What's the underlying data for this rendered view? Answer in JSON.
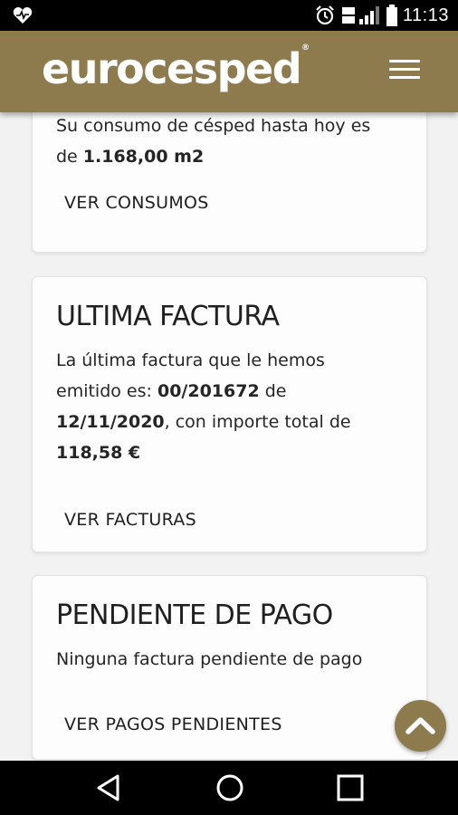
{
  "status_bar": {
    "time": "11:13",
    "icons": [
      "heart-icon",
      "alarm-icon",
      "lte-signal-icon",
      "battery-icon"
    ]
  },
  "header": {
    "logo_text": "eurocesped",
    "logo_reg_mark": "®",
    "menu_icon": "hamburger-menu-icon",
    "background_color": "#8d7a4d"
  },
  "cards": {
    "consumo": {
      "line1": "Su consumo de césped hasta hoy es",
      "line2_prefix": "de ",
      "amount": "1.168,00 m2",
      "link": "VER CONSUMOS"
    },
    "factura": {
      "title": "ULTIMA FACTURA",
      "line1": "La última factura que le hemos",
      "line2_prefix": "emitido es: ",
      "invoice_number": "00/201672",
      "line2_suffix": " de",
      "date": "12/11/2020",
      "line3_suffix": ", con importe total de",
      "total": "118,58 €",
      "link": "VER FACTURAS"
    },
    "pendiente": {
      "title": "PENDIENTE DE PAGO",
      "body": "Ninguna factura pendiente de pago",
      "link": "VER PAGOS PENDIENTES"
    }
  },
  "fab": {
    "icon": "chevron-up-icon"
  },
  "nav_bar": {
    "icons": [
      "back-icon",
      "home-icon",
      "recents-icon"
    ]
  }
}
